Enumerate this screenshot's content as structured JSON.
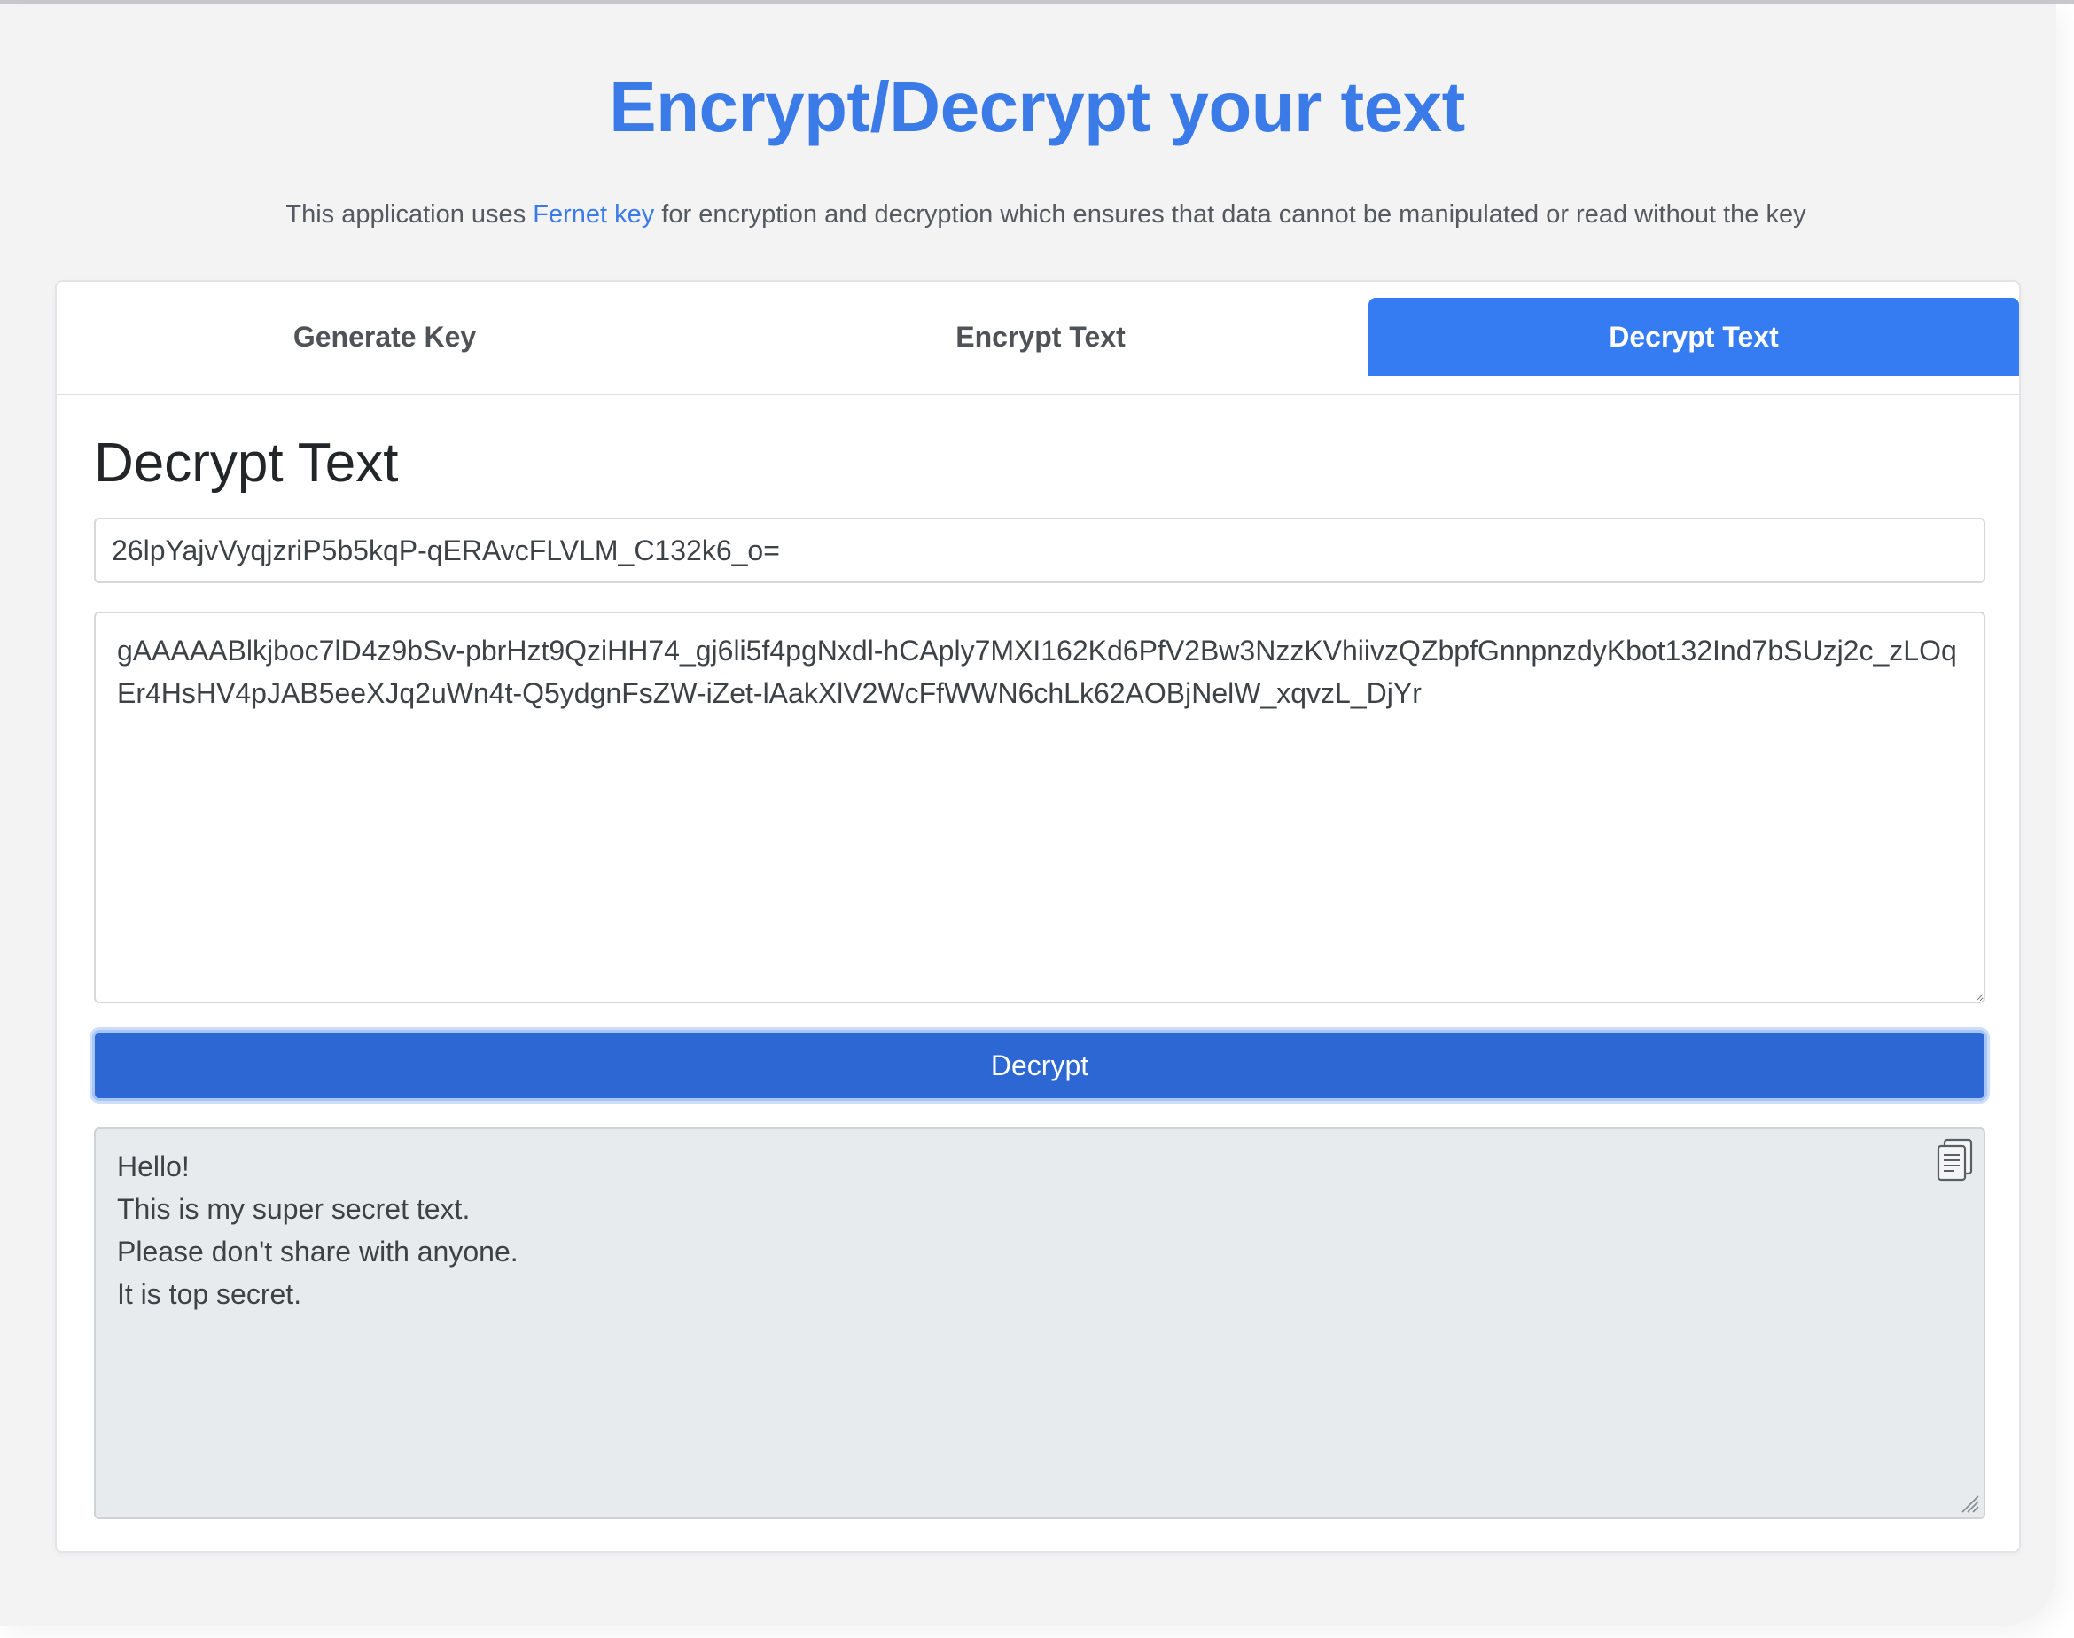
{
  "header": {
    "title": "Encrypt/Decrypt your text",
    "intro_before": "This application uses ",
    "intro_link": "Fernet key",
    "intro_after": " for encryption and decryption which ensures that data cannot be manipulated or read without the key"
  },
  "tabs": [
    {
      "label": "Generate Key",
      "active": false
    },
    {
      "label": "Encrypt Text",
      "active": false
    },
    {
      "label": "Decrypt Text",
      "active": true
    }
  ],
  "decrypt": {
    "section_title": "Decrypt Text",
    "key_value": "26lpYajvVyqjzriP5b5kqP-qERAvcFLVLM_C132k6_o=",
    "ciphertext": "gAAAAABlkjboc7lD4z9bSv-pbrHzt9QziHH74_gj6li5f4pgNxdl-hCAply7MXI162Kd6PfV2Bw3NzzKVhiivzQZbpfGnnpnzdyKbot132Ind7bSUzj2c_zLOqEr4HsHV4pJAB5eeXJq2uWn4t-Q5ydgnFsZW-iZet-lAakXlV2WcFfWWN6chLk62AOBjNelW_xqvzL_DjYr",
    "button_label": "Decrypt",
    "output_lines": [
      "Hello!",
      "This is my super secret text.",
      "Please don't share with anyone.",
      "It is top secret."
    ],
    "copy_icon": "copy-icon"
  },
  "colors": {
    "accent": "#357bf2",
    "title": "#3a7be8",
    "button": "#2d67d4",
    "output_bg": "#e8ebee"
  }
}
